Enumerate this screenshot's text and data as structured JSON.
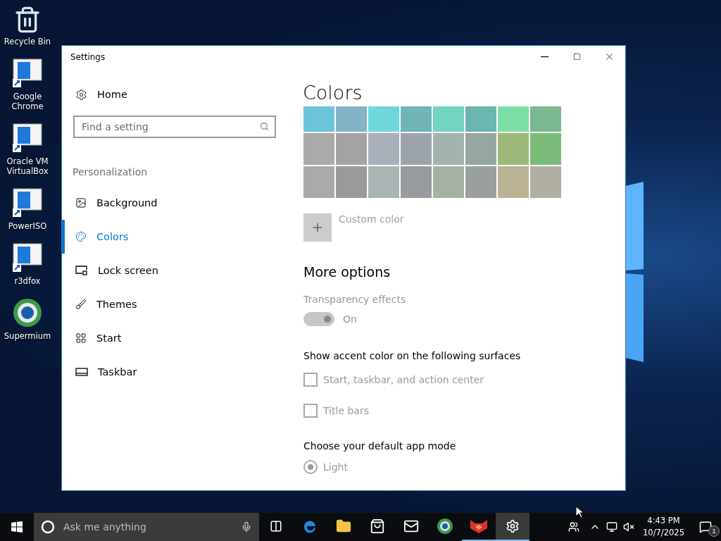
{
  "desktop_icons": [
    {
      "label": "Recycle Bin",
      "kind": "bin"
    },
    {
      "label": "Google Chrome",
      "kind": "shortcut"
    },
    {
      "label": "Oracle VM VirtualBox",
      "kind": "shortcut"
    },
    {
      "label": "PowerISO",
      "kind": "shortcut"
    },
    {
      "label": "r3dfox",
      "kind": "shortcut"
    },
    {
      "label": "Supermium",
      "kind": "globe"
    }
  ],
  "window": {
    "title": "Settings"
  },
  "sidebar": {
    "home": "Home",
    "search": {
      "placeholder": "Find a setting"
    },
    "section": "Personalization",
    "items": [
      {
        "label": "Background",
        "kind": "image",
        "selected": false
      },
      {
        "label": "Colors",
        "kind": "palette",
        "selected": true
      },
      {
        "label": "Lock screen",
        "kind": "lock",
        "selected": false
      },
      {
        "label": "Themes",
        "kind": "brush",
        "selected": false
      },
      {
        "label": "Start",
        "kind": "grid",
        "selected": false
      },
      {
        "label": "Taskbar",
        "kind": "taskbar",
        "selected": false
      }
    ]
  },
  "content": {
    "title": "Colors",
    "swatches": [
      {
        "color": "#6cc4da"
      },
      {
        "color": "#85b3c6"
      },
      {
        "color": "#6fd6dc"
      },
      {
        "color": "#6fb5b5"
      },
      {
        "color": "#74d4c4"
      },
      {
        "color": "#6cb6b0"
      },
      {
        "color": "#7ddfa8"
      },
      {
        "color": "#7ab88f"
      },
      {
        "color": "#aaaaaa"
      },
      {
        "color": "#a4a2a2"
      },
      {
        "color": "#a9b0ba"
      },
      {
        "color": "#9ca3ab"
      },
      {
        "color": "#a3b3ad"
      },
      {
        "color": "#98a6a2"
      },
      {
        "color": "#9cb87a"
      },
      {
        "color": "#7bbb7a"
      },
      {
        "color": "#aaaaaa"
      },
      {
        "color": "#9b9a9a"
      },
      {
        "color": "#abb4b5"
      },
      {
        "color": "#979ba0"
      },
      {
        "color": "#a6b1a4"
      },
      {
        "color": "#9aa19c"
      },
      {
        "color": "#b9b294"
      },
      {
        "color": "#b1aea3"
      }
    ],
    "custom_color": "Custom color",
    "more_options": "More options",
    "transparency": {
      "label": "Transparency effects",
      "on": true,
      "disabled": true,
      "state_text": "On"
    },
    "accent_heading": "Show accent color on the following surfaces",
    "accent_options": [
      {
        "label": "Start, taskbar, and action center",
        "checked": false,
        "disabled": true
      },
      {
        "label": "Title bars",
        "checked": false,
        "disabled": true
      }
    ],
    "app_mode": {
      "heading": "Choose your default app mode",
      "options": [
        {
          "label": "Light",
          "selected": true,
          "disabled": true
        }
      ]
    }
  },
  "taskbar": {
    "search": {
      "placeholder": "Ask me anything"
    },
    "apps": [
      {
        "kind": "task-view",
        "running": false,
        "selected": false
      },
      {
        "kind": "edge",
        "running": false,
        "selected": false
      },
      {
        "kind": "folder",
        "running": false,
        "selected": false
      },
      {
        "kind": "store",
        "running": false,
        "selected": false
      },
      {
        "kind": "mail",
        "running": false,
        "selected": false
      },
      {
        "kind": "globe",
        "running": false,
        "selected": false
      },
      {
        "kind": "fox",
        "running": true,
        "selected": false
      },
      {
        "kind": "settings",
        "running": true,
        "selected": true
      }
    ],
    "clock": {
      "time": "4:43 PM",
      "date": "10/7/2025"
    },
    "notifications": {
      "count": "1"
    }
  }
}
